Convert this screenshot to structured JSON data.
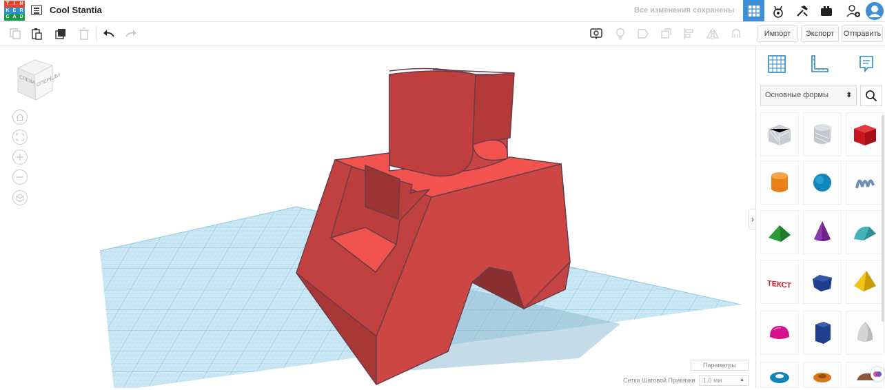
{
  "app": {
    "logo_letters": [
      "T",
      "I",
      "N",
      "K",
      "E",
      "R",
      "C",
      "A",
      "D"
    ],
    "logo_colors": [
      "#e8472e",
      "#e8472e",
      "#e8472e",
      "#2d8fd5",
      "#2d8fd5",
      "#2d8fd5",
      "#1a9b4b",
      "#1a9b4b",
      "#1a9b4b"
    ],
    "design_title": "Cool Stantia",
    "save_status": "Все изменения сохранены"
  },
  "topbar_buttons": [
    {
      "icon": "grid-view-icon",
      "active": true
    },
    {
      "icon": "blocks-icon",
      "active": false
    },
    {
      "icon": "bricks-icon",
      "active": false
    },
    {
      "icon": "sim-lab-icon",
      "active": false
    },
    {
      "icon": "add-user-icon",
      "active": false
    },
    {
      "icon": "profile-avatar-icon",
      "active": false
    }
  ],
  "toolbar": {
    "import_label": "Импорт",
    "export_label": "Экспорт",
    "send_label": "Отправить"
  },
  "viewcube": {
    "front_label": "СПЕРЕДИ",
    "left_label": "СЛЕВА"
  },
  "viewport": {
    "params_label": "Параметры",
    "snap_label": "Сетка Шаговой Привязки",
    "snap_value": "1.0 мм"
  },
  "panel": {
    "library_name": "Основные формы",
    "shapes": [
      {
        "name": "Ящик",
        "icon": "hole-box-icon"
      },
      {
        "name": "Цилиндр отверстие",
        "icon": "hole-cylinder-icon"
      },
      {
        "name": "Кубик",
        "icon": "box-icon"
      },
      {
        "name": "Цилиндр",
        "icon": "cylinder-icon"
      },
      {
        "name": "Сфера",
        "icon": "sphere-icon"
      },
      {
        "name": "Скрайб",
        "icon": "scribble-icon"
      },
      {
        "name": "Крыша",
        "icon": "roof-icon"
      },
      {
        "name": "Конус",
        "icon": "cone-icon"
      },
      {
        "name": "Круглая крыша",
        "icon": "round-roof-icon"
      },
      {
        "name": "Текст",
        "icon": "text-icon"
      },
      {
        "name": "Многоугольник",
        "icon": "polygon-prism-icon"
      },
      {
        "name": "Пирамида",
        "icon": "pyramid-icon"
      },
      {
        "name": "Полусфера",
        "icon": "half-sphere-icon"
      },
      {
        "name": "Шестигранник",
        "icon": "hexagonal-prism-icon"
      },
      {
        "name": "Параболоид",
        "icon": "paraboloid-icon"
      },
      {
        "name": "Тор",
        "icon": "torus-icon"
      },
      {
        "name": "Трубка",
        "icon": "tube-icon"
      },
      {
        "name": "Фигура",
        "icon": "figure-icon"
      }
    ]
  },
  "colors": {
    "model_red": "#cd3f3d",
    "grid_blue": "#c5e4f2",
    "active_blue": "#3e8fd6"
  }
}
